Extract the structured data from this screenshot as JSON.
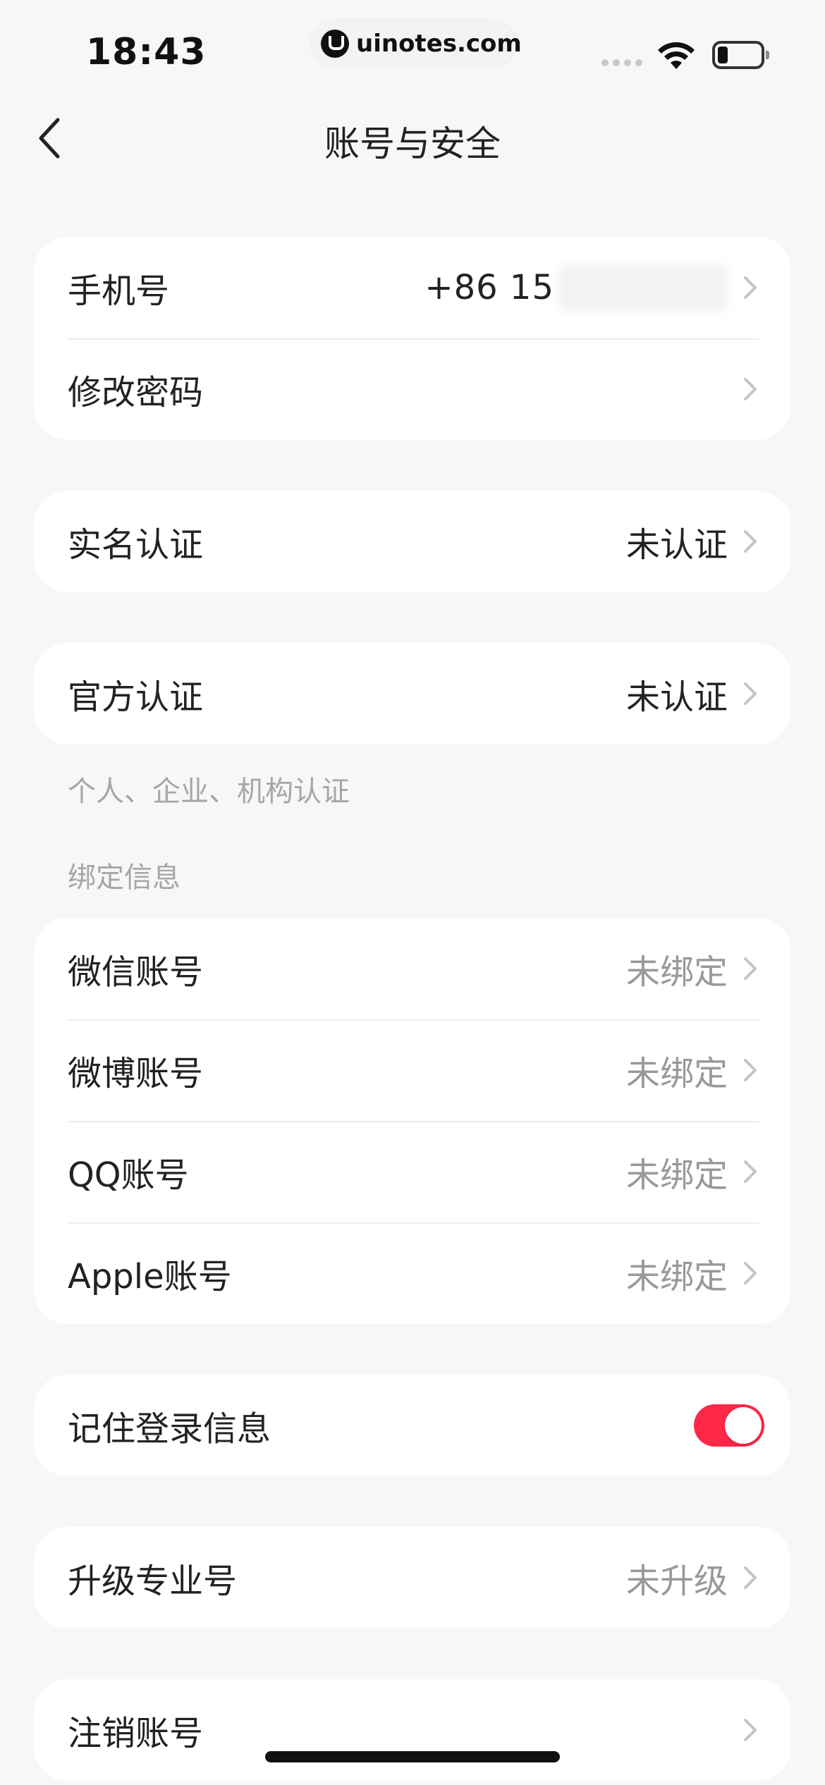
{
  "status_bar": {
    "time": "18:43",
    "watermark_text": "uinotes.com",
    "icons": [
      "cellular-signal-icon",
      "wifi-icon",
      "battery-icon"
    ]
  },
  "nav": {
    "back_icon": "chevron-left-icon",
    "title": "账号与安全"
  },
  "account": {
    "phone_label": "手机号",
    "phone_value": "+86 15",
    "password_label": "修改密码"
  },
  "realname": {
    "label": "实名认证",
    "value": "未认证"
  },
  "official": {
    "label": "官方认证",
    "value": "未认证",
    "note": "个人、企业、机构认证"
  },
  "binding": {
    "section_title": "绑定信息",
    "items": [
      {
        "label": "微信账号",
        "value": "未绑定"
      },
      {
        "label": "微博账号",
        "value": "未绑定"
      },
      {
        "label": "QQ账号",
        "value": "未绑定"
      },
      {
        "label": "Apple账号",
        "value": "未绑定"
      }
    ]
  },
  "remember": {
    "label": "记住登录信息",
    "enabled": true,
    "accent_color": "#ff2748"
  },
  "pro": {
    "label": "升级专业号",
    "value": "未升级"
  },
  "cancel": {
    "label": "注销账号"
  },
  "colors": {
    "background": "#f7f7f7",
    "card": "#ffffff",
    "text_primary": "#222222",
    "text_secondary": "#999999"
  }
}
